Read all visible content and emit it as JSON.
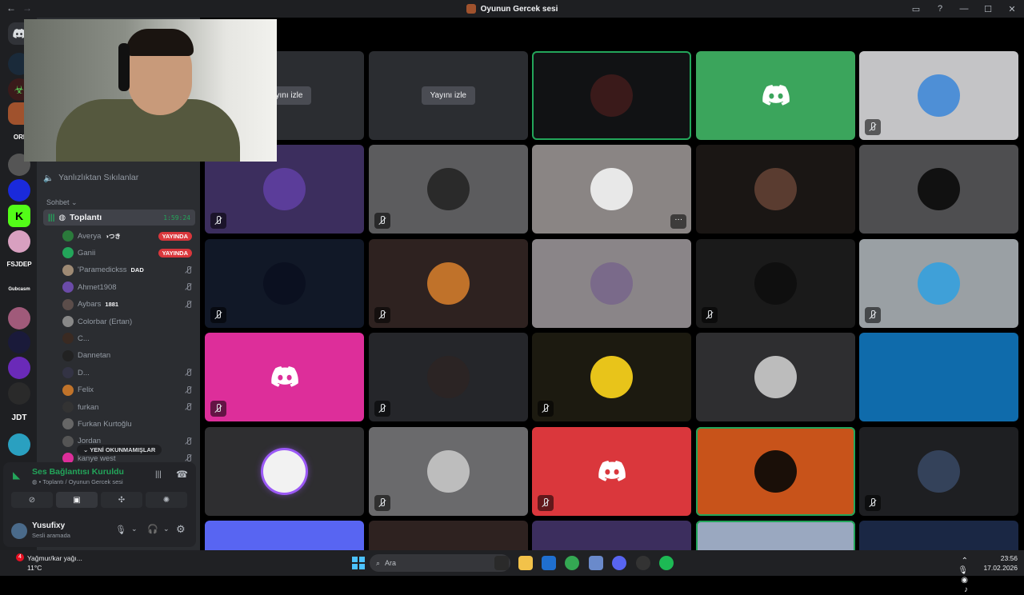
{
  "window": {
    "title": "Oyunun Gercek sesi",
    "back": "←",
    "forward": "→",
    "controls": [
      "▭",
      "?",
      "—",
      "☐",
      "✕"
    ]
  },
  "server_rail": {
    "text_items": [
      "ORI",
      "FSJDEP",
      "Gubcasm",
      "JDT"
    ]
  },
  "sidebar": {
    "channels": [
      {
        "name": "Yanlızlıktan Sıkılanlar"
      }
    ],
    "category": "Sohbet",
    "active_channel": {
      "name": "Toplantı",
      "timer": "1:59:24"
    },
    "members": [
      {
        "name": "Averya",
        "tag": "◑つき",
        "badge": "YAYINDA",
        "muted": false,
        "color": "#2b7a3b"
      },
      {
        "name": "Ganii",
        "badge": "YAYINDA",
        "muted": false,
        "color": "#23a55a"
      },
      {
        "name": "'Paramedickss",
        "tag": "DAD",
        "muted": true,
        "color": "#9e8a74"
      },
      {
        "name": "Ahmet1908",
        "muted": true,
        "color": "#6b4ba8"
      },
      {
        "name": "Aybars",
        "tag": "1881",
        "muted": true,
        "color": "#5b4d4a"
      },
      {
        "name": "Colorbar (Ertan)",
        "muted": false,
        "color": "#888888"
      },
      {
        "name": "C...",
        "muted": false,
        "color": "#3a2a22"
      },
      {
        "name": "Dannetan",
        "muted": false,
        "color": "#222222"
      },
      {
        "name": "D...",
        "muted": true,
        "color": "#333344"
      },
      {
        "name": "Felix",
        "muted": true,
        "color": "#c0732a"
      },
      {
        "name": "furkan",
        "muted": true,
        "color": "#333333"
      },
      {
        "name": "Furkan Kurtoğlu",
        "muted": false,
        "color": "#666666"
      },
      {
        "name": "Jordan",
        "muted": true,
        "color": "#555555"
      },
      {
        "name": "kanye west",
        "muted": true,
        "color": "#dd2e9a"
      }
    ],
    "new_unread": "YENİ OKUNMAMIŞLAR"
  },
  "voice_panel": {
    "status": "Ses Bağlantısı Kuruldu",
    "location": "Toplantı / Oyunun Gercek sesi",
    "username": "Yusufixy",
    "user_status": "Sesli aramada"
  },
  "tiles": [
    {
      "bg": "#2b2d31",
      "type": "stream",
      "label": "Yayını izle"
    },
    {
      "bg": "#2b2d31",
      "type": "stream",
      "label": "Yayını izle"
    },
    {
      "bg": "#111214",
      "type": "avatar",
      "avatar": "#3a1a1a",
      "speaking": true
    },
    {
      "bg": "#3ba55c",
      "type": "discord"
    },
    {
      "bg": "#c4c4c6",
      "type": "avatar",
      "avatar": "#4e8fd6",
      "muted": true
    },
    {
      "bg": "#3c2e5e",
      "type": "avatar",
      "avatar": "#5b3d9a",
      "muted": true
    },
    {
      "bg": "#5c5c5e",
      "type": "avatar",
      "avatar": "#2a2a2a",
      "muted": true
    },
    {
      "bg": "#8a8584",
      "type": "avatar",
      "avatar": "#e8e8e8",
      "more": true
    },
    {
      "bg": "#1a1614",
      "type": "avatar",
      "avatar": "#5a3c30"
    },
    {
      "bg": "#4e4e50",
      "type": "avatar",
      "avatar": "#111111"
    },
    {
      "bg": "#111827",
      "type": "avatar",
      "avatar": "#0b1020",
      "muted": true
    },
    {
      "bg": "#2e2220",
      "type": "avatar",
      "avatar": "#c0722a",
      "muted": true
    },
    {
      "bg": "#8a8588",
      "type": "avatar",
      "avatar": "#7a6a8a"
    },
    {
      "bg": "#1a1a1a",
      "type": "avatar",
      "avatar": "#0f0f0f",
      "muted": true
    },
    {
      "bg": "#9aa0a4",
      "type": "avatar",
      "avatar": "#3fa0d8",
      "muted": true
    },
    {
      "bg": "#dd2e9a",
      "type": "discord",
      "muted": true
    },
    {
      "bg": "#25262a",
      "type": "avatar",
      "avatar": "#2b2424",
      "muted": true
    },
    {
      "bg": "#1c1a10",
      "type": "avatar",
      "avatar": "#e8c41a",
      "muted": true
    },
    {
      "bg": "#2e2e30",
      "type": "avatar",
      "avatar": "#bcbcbc"
    },
    {
      "bg": "#0f6bab",
      "type": "plain"
    },
    {
      "bg": "#2e2e30",
      "type": "avatar",
      "avatar": "#f2f2f2",
      "glow": true
    },
    {
      "bg": "#6a6a6c",
      "type": "avatar",
      "avatar": "#bdbdbd",
      "muted": true
    },
    {
      "bg": "#da373c",
      "type": "discord",
      "muted": true
    },
    {
      "bg": "#c8531a",
      "type": "avatar",
      "avatar": "#1a0f08",
      "speaking": true
    },
    {
      "bg": "#1e1f22",
      "type": "avatar",
      "avatar": "#34425a",
      "muted": true
    },
    {
      "bg": "#5865f2",
      "type": "plain"
    },
    {
      "bg": "#2e2220",
      "type": "plain"
    },
    {
      "bg": "#3c2e5e",
      "type": "plain"
    },
    {
      "bg": "#9aa8c0",
      "type": "plain",
      "speaking": true
    },
    {
      "bg": "#1a2744",
      "type": "plain"
    }
  ],
  "taskbar": {
    "weather": "Yağmur/kar yağı...",
    "temp": "11°C",
    "notif_count": "4",
    "search_placeholder": "Ara",
    "time": "23:56",
    "date": "17.02.2026"
  }
}
